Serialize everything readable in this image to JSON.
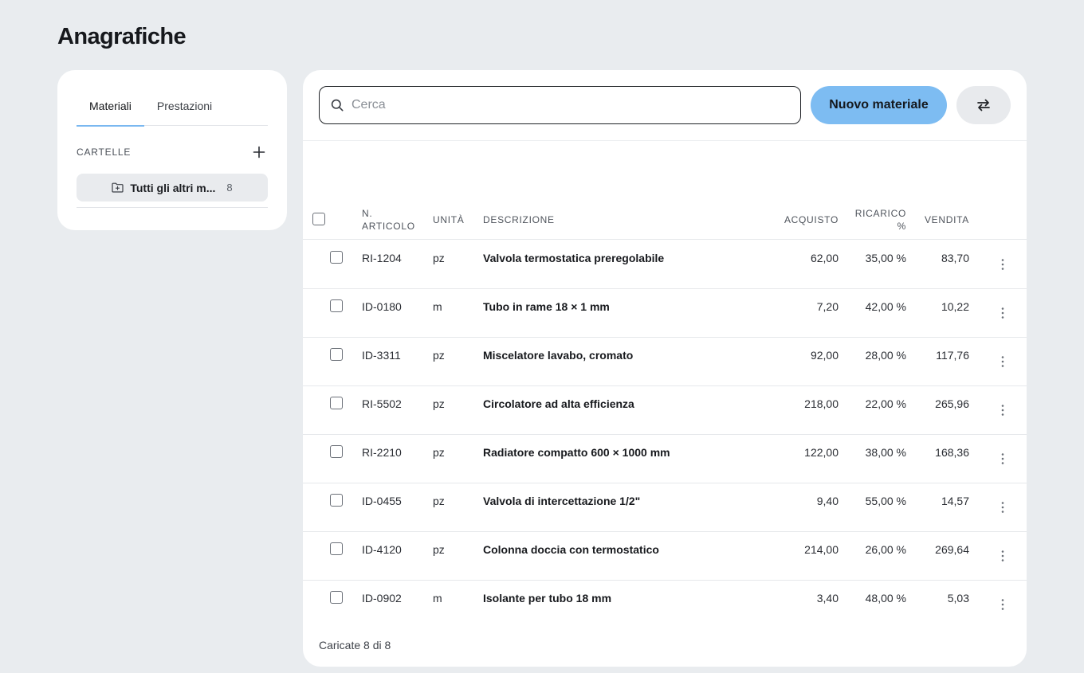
{
  "page": {
    "title": "Anagrafiche"
  },
  "sidebar": {
    "tabs": [
      {
        "label": "Materiali",
        "active": true
      },
      {
        "label": "Prestazioni",
        "active": false
      }
    ],
    "folders_label": "CARTELLE",
    "folder": {
      "name": "Tutti gli altri m...",
      "count": "8"
    }
  },
  "toolbar": {
    "search_placeholder": "Cerca",
    "new_button": "Nuovo materiale"
  },
  "table": {
    "headers": {
      "code_line1": "N.",
      "code_line2": "ARTICOLO",
      "unit": "UNITÀ",
      "description": "DESCRIZIONE",
      "purchase": "ACQUISTO",
      "markup_line1": "RICARICO",
      "markup_line2": "%",
      "sale": "VENDITA"
    },
    "rows": [
      {
        "code": "RI-1204",
        "unit": "pz",
        "description": "Valvola termostatica preregolabile",
        "purchase": "62,00",
        "markup": "35,00 %",
        "sale": "83,70"
      },
      {
        "code": "ID-0180",
        "unit": "m",
        "description": "Tubo in rame 18 × 1 mm",
        "purchase": "7,20",
        "markup": "42,00 %",
        "sale": "10,22"
      },
      {
        "code": "ID-3311",
        "unit": "pz",
        "description": "Miscelatore lavabo, cromato",
        "purchase": "92,00",
        "markup": "28,00 %",
        "sale": "117,76"
      },
      {
        "code": "RI-5502",
        "unit": "pz",
        "description": "Circolatore ad alta efficienza",
        "purchase": "218,00",
        "markup": "22,00 %",
        "sale": "265,96"
      },
      {
        "code": "RI-2210",
        "unit": "pz",
        "description": "Radiatore compatto 600 × 1000 mm",
        "purchase": "122,00",
        "markup": "38,00 %",
        "sale": "168,36"
      },
      {
        "code": "ID-0455",
        "unit": "pz",
        "description": "Valvola di intercettazione 1/2\"",
        "purchase": "9,40",
        "markup": "55,00 %",
        "sale": "14,57"
      },
      {
        "code": "ID-4120",
        "unit": "pz",
        "description": "Colonna doccia con termostatico",
        "purchase": "214,00",
        "markup": "26,00 %",
        "sale": "269,64"
      },
      {
        "code": "ID-0902",
        "unit": "m",
        "description": "Isolante per tubo 18 mm",
        "purchase": "3,40",
        "markup": "48,00 %",
        "sale": "5,03"
      }
    ]
  },
  "footer": {
    "loaded_text": "Caricate 8 di 8"
  },
  "colors": {
    "accent": "#7dbcf2",
    "background": "#e9ecef",
    "tab_underline": "#7ab8f0"
  },
  "icons": {
    "search": "search-icon",
    "add": "plus-icon",
    "folder": "folder-icon",
    "swap": "swap-arrows-icon",
    "row_menu": "kebab-menu-icon"
  }
}
